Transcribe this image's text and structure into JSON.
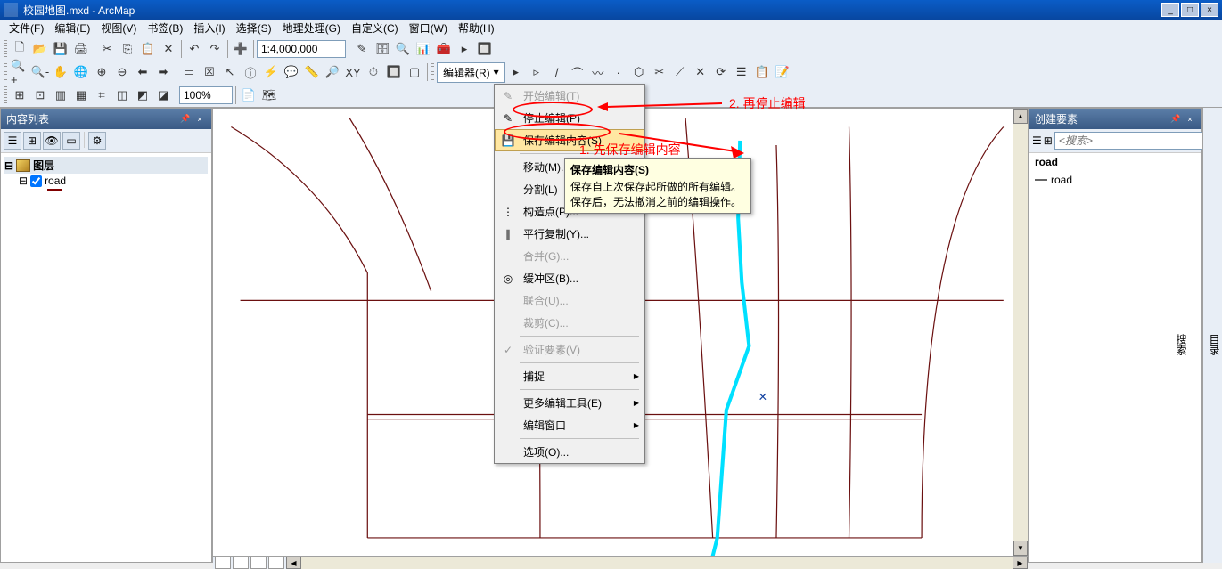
{
  "title": "校园地图.mxd - ArcMap",
  "menubar": [
    "文件(F)",
    "编辑(E)",
    "视图(V)",
    "书签(B)",
    "插入(I)",
    "选择(S)",
    "地理处理(G)",
    "自定义(C)",
    "窗口(W)",
    "帮助(H)"
  ],
  "scale": "1:4,000,000",
  "zoom_pct": "100%",
  "editor_button": "编辑器(R)",
  "toc": {
    "title": "内容列表",
    "root": "图层",
    "layer": "road"
  },
  "editor_menu": {
    "start": "开始编辑(T)",
    "stop": "停止编辑(P)",
    "save": "保存编辑内容(S)",
    "move": "移动(M)...",
    "split": "分割(L)",
    "construct_points": "构造点(P)...",
    "parallel_copy": "平行复制(Y)...",
    "merge": "合并(G)...",
    "buffer": "缓冲区(B)...",
    "union": "联合(U)...",
    "clip": "裁剪(C)...",
    "validate": "验证要素(V)",
    "snapping": "捕捉",
    "more_tools": "更多编辑工具(E)",
    "edit_window": "编辑窗口",
    "options": "选项(O)..."
  },
  "tooltip": {
    "title": "保存编辑内容(S)",
    "body": "保存自上次保存起所做的所有编辑。保存后，无法撤消之前的编辑操作。"
  },
  "annotations": {
    "anno1": "1. 先保存编辑内容",
    "anno2": "2. 再停止编辑"
  },
  "create_panel": {
    "title": "创建要素",
    "search_placeholder": "<搜索>",
    "header": "road",
    "item": "road"
  },
  "right_tabs": [
    "目录",
    "搜索"
  ]
}
